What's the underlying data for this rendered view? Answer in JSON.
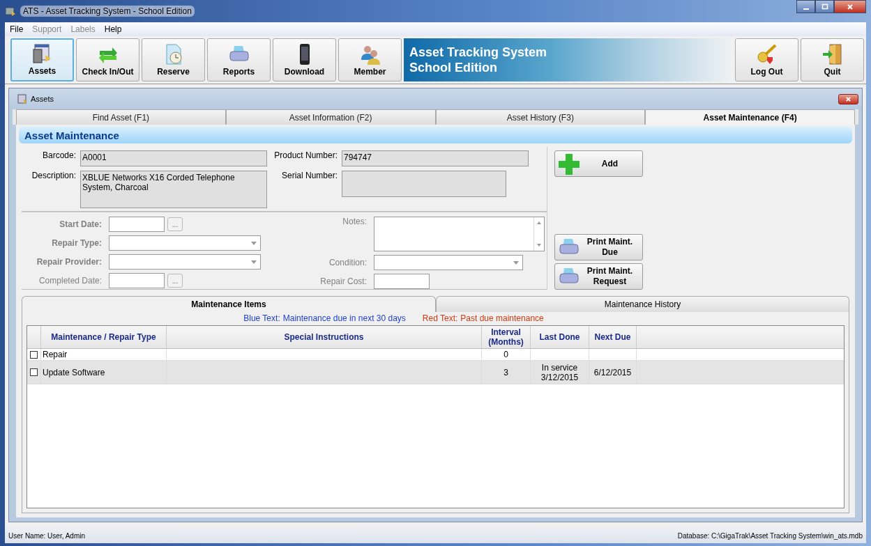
{
  "window": {
    "title": "ATS - Asset Tracking System - School Edition"
  },
  "menu": [
    {
      "label": "File",
      "disabled": false
    },
    {
      "label": "Support",
      "disabled": true
    },
    {
      "label": "Labels",
      "disabled": true
    },
    {
      "label": "Help",
      "disabled": false
    }
  ],
  "toolbar": [
    {
      "label": "Assets",
      "kind": "assets",
      "selected": true
    },
    {
      "label": "Check In/Out",
      "kind": "swap",
      "selected": false
    },
    {
      "label": "Reserve",
      "kind": "reserve",
      "selected": false
    },
    {
      "label": "Reports",
      "kind": "printer",
      "selected": false
    },
    {
      "label": "Download",
      "kind": "phone",
      "selected": false
    },
    {
      "label": "Member",
      "kind": "people",
      "selected": false
    }
  ],
  "banner": {
    "line1": "Asset Tracking System",
    "line2": "School Edition"
  },
  "toolbar_right": [
    {
      "label": "Log Out",
      "kind": "key"
    },
    {
      "label": "Quit",
      "kind": "door"
    }
  ],
  "child_window": {
    "title": "Assets"
  },
  "tabs": [
    {
      "label": "Find Asset (F1)",
      "selected": false
    },
    {
      "label": "Asset Information (F2)",
      "selected": false
    },
    {
      "label": "Asset History (F3)",
      "selected": false
    },
    {
      "label": "Asset Maintenance (F4)",
      "selected": true
    }
  ],
  "section_title": "Asset Maintenance",
  "asset": {
    "barcode_label": "Barcode:",
    "barcode": "A0001",
    "description_label": "Description:",
    "description": "XBLUE Networks X16 Corded Telephone System, Charcoal",
    "product_label": "Product Number:",
    "product": "794747",
    "serial_label": "Serial Number:"
  },
  "maint_left": [
    {
      "label": "Start Date:",
      "kind": "date",
      "required": true,
      "disabled": true,
      "button": "..."
    },
    {
      "label": "Repair Type:",
      "kind": "select",
      "required": true,
      "disabled": true
    },
    {
      "label": "Repair Provider:",
      "kind": "select",
      "required": true,
      "disabled": true
    },
    {
      "label": "Completed Date:",
      "kind": "date",
      "required": false,
      "disabled": true,
      "button": "..."
    }
  ],
  "maint_right": [
    {
      "label": "Notes:",
      "kind": "textarea",
      "required": false,
      "disabled": true
    },
    {
      "label": "Condition:",
      "kind": "select",
      "required": false,
      "disabled": true
    },
    {
      "label": "Repair Cost:",
      "kind": "text",
      "required": false,
      "disabled": true
    }
  ],
  "actions": [
    {
      "label": "Add",
      "kind": "add"
    },
    {
      "label": "Print Maint. Due",
      "kind": "printer"
    },
    {
      "label": "Print Maint. Request",
      "kind": "printer"
    }
  ],
  "sub_tabs": [
    {
      "label": "Maintenance Items",
      "selected": true
    },
    {
      "label": "Maintenance History",
      "selected": false
    }
  ],
  "legend": [
    {
      "label": "Blue Text:",
      "text": "Maintenance due in next 30 days",
      "color": "#1f3fcf"
    },
    {
      "label": "Red Text:",
      "text": "Past due maintenance",
      "color": "#d03a10"
    }
  ],
  "table": {
    "columns": [
      "Maintenance / Repair Type",
      "Special Instructions",
      "Interval (Months)",
      "Last Done",
      "Next Due"
    ],
    "rows": [
      {
        "checked": false,
        "selected": false,
        "cells": [
          "Repair",
          "",
          "0",
          "",
          ""
        ]
      },
      {
        "checked": false,
        "selected": true,
        "cells": [
          "Update Software",
          "",
          "3",
          "In service 3/12/2015",
          "6/12/2015"
        ]
      }
    ]
  },
  "status_bar": {
    "user": "User Name:  User, Admin",
    "database": "Database:  C:\\GigaTrak\\Asset Tracking System\\win_ats.mdb"
  }
}
